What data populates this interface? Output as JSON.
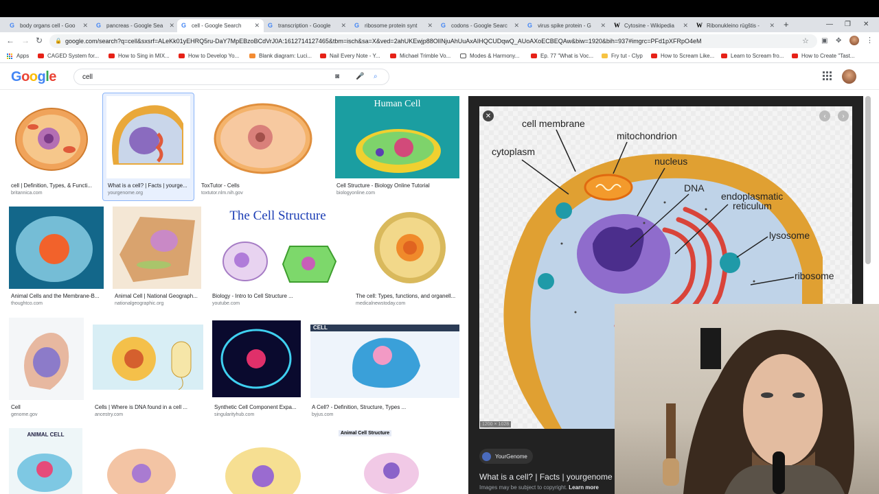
{
  "browser": {
    "tabs": [
      {
        "label": "body organs cell - Goo"
      },
      {
        "label": "pancreas - Google Sea"
      },
      {
        "label": "cell - Google Search"
      },
      {
        "label": "transcription - Google"
      },
      {
        "label": "ribosome protein synt"
      },
      {
        "label": "codons - Google Searc"
      },
      {
        "label": "virus spike protein - G"
      },
      {
        "label": "Cytosine - Wikipedia"
      },
      {
        "label": "Ribonukleino rūgštis -"
      }
    ],
    "url": "google.com/search?q=cell&sxsrf=ALeKk01yEHRQ5ru-DaY7MpEBzoBCdVrJ0A:1612714127465&tbm=isch&sa=X&ved=2ahUKEwjp88OlINjuAhUuAxAIHQCUDqwQ_AUoAXoECBEQAw&biw=1920&bih=937#imgrc=PFd1pXFRpO4eM",
    "bookmarks": [
      "Apps",
      "CAGED System for...",
      "How to Sing in MIX...",
      "How to Develop Yo...",
      "Blank diagram: Luci...",
      "Nail Every Note - Y...",
      "Michael Trimble Vo...",
      "Modes & Harmony...",
      "Ep. 77 \"What is Voc...",
      "Fry tut - Clyp",
      "How to Scream Like...",
      "Learn to Scream fro...",
      "How to Create \"Tast..."
    ]
  },
  "search": {
    "logo": "Google",
    "query": "cell"
  },
  "results": [
    {
      "caption": "cell | Definition, Types, & Functi...",
      "source": "britannica.com"
    },
    {
      "caption": "What is a cell? | Facts | yourge...",
      "source": "yourgenome.org"
    },
    {
      "caption": "ToxTutor - Cells",
      "source": "toxtutor.nlm.nih.gov"
    },
    {
      "caption": "Cell Structure - Biology Online Tutorial",
      "source": "biologyonline.com"
    },
    {
      "caption": "Animal Cells and the Membrane-B...",
      "source": "thoughtco.com"
    },
    {
      "caption": "Animal Cell | National Geograph...",
      "source": "nationalgeographic.org"
    },
    {
      "caption": "Biology - Intro to Cell Structure ...",
      "source": "youtube.com"
    },
    {
      "caption": "The cell: Types, functions, and organell...",
      "source": "medicalnewstoday.com"
    },
    {
      "caption": "Cell",
      "source": "genome.gov"
    },
    {
      "caption": "Cells | Where is DNA found in a cell ...",
      "source": "ancestry.com"
    },
    {
      "caption": "Synthetic Cell Component Expa...",
      "source": "singularityhub.com"
    },
    {
      "caption": "A Cell? - Definition, Structure, Types ...",
      "source": "byjus.com"
    }
  ],
  "thumb_text": {
    "human_cell": "Human Cell",
    "cell_structure": "The Cell Structure",
    "animal_cell": "ANIMAL CELL",
    "animal_cell_structure": "Animal Cell Structure",
    "cell_header": "CELL"
  },
  "preview": {
    "labels": {
      "cell_membrane": "cell membrane",
      "mitochondrion": "mitochondrion",
      "cytoplasm": "cytoplasm",
      "nucleus": "nucleus",
      "dna": "DNA",
      "er_line1": "endoplasmatic",
      "er_line2": "reticulum",
      "lysosome": "lysosome",
      "ribosome": "ribosome"
    },
    "dimensions": "1200 × 1028",
    "source_name": "YourGenome",
    "title": "What is a cell? | Facts | yourgenome",
    "copyright": "Images may be subject to copyright.",
    "learn_more": "Learn more"
  }
}
